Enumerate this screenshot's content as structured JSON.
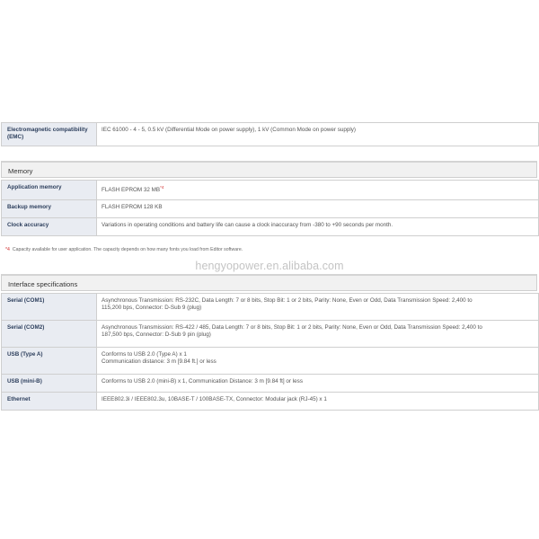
{
  "emc": {
    "label": "Electromagnetic compatibility (EMC)",
    "value": "IEC 61000 - 4 - 5, 0.5 kV (Differential Mode on power supply), 1 kV (Common Mode on power supply)"
  },
  "memory": {
    "title": "Memory",
    "rows": [
      {
        "label": "Application memory",
        "value": "FLASH EPROM 32 MB",
        "note": "*4"
      },
      {
        "label": "Backup memory",
        "value": "FLASH EPROM 128 KB"
      },
      {
        "label": "Clock accuracy",
        "value": "Variations in operating conditions and battery life can cause a clock inaccuracy from -380 to +90 seconds per month."
      }
    ],
    "footnote": {
      "mark": "*4",
      "text": "Capacity available for user application. The capacity depends on how many fonts you load from Editor software."
    }
  },
  "watermark": "hengyopower.en.alibaba.com",
  "interface": {
    "title": "Interface specifications",
    "rows": [
      {
        "label": "Serial (COM1)",
        "line1": "Asynchronous Transmission: RS-232C, Data Length: 7 or 8 bits, Stop Bit: 1 or 2 bits, Parity: None, Even or Odd, Data Transmission Speed: 2,400 to",
        "line2": "115,200 bps, Connector: D-Sub 9 (plug)"
      },
      {
        "label": "Serial (COM2)",
        "line1": "Asynchronous Transmission: RS-422 / 485, Data Length: 7 or 8 bits, Stop Bit: 1 or 2 bits, Parity: None, Even or Odd, Data Transmission Speed: 2,400 to",
        "line2": "187,500 bps, Connector: D-Sub 9 pin (plug)"
      },
      {
        "label": "USB (Type A)",
        "line1": "Conforms to USB 2.0 (Type A) x 1",
        "line2": "Communication distance: 3 m [9.84 ft.] or less"
      },
      {
        "label": "USB (mini-B)",
        "line1": "Conforms to USB 2.0 (mini-B) x 1, Communication Distance: 3 m [9.84 ft] or less",
        "line2": ""
      },
      {
        "label": "Ethernet",
        "line1": "IEEE802.3i / IEEE802.3u, 10BASE-T / 100BASE-TX, Connector: Modular jack (RJ-45) x 1",
        "line2": ""
      }
    ]
  }
}
